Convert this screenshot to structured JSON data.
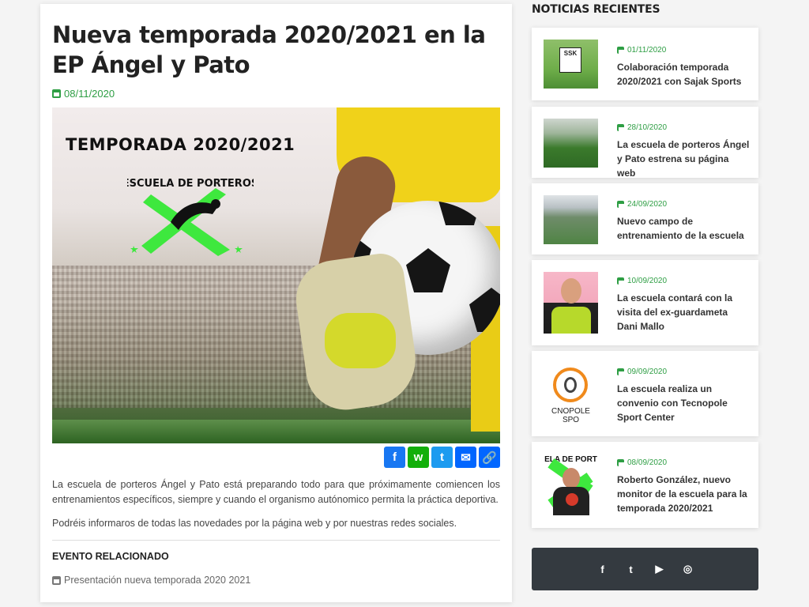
{
  "article": {
    "title": "Nueva temporada 2020/2021 en la EP Ángel y Pato",
    "date": "08/11/2020",
    "hero_heading": "TEMPORADA 2020/2021",
    "hero_logo_text": "ESCUELA DE PORTEROS",
    "share": [
      "f",
      "w",
      "t",
      "✉",
      "🔗"
    ],
    "paragraphs": [
      "La escuela de porteros Ángel y Pato está preparando todo para que próximamente comiencen los entrenamientos específicos, siempre y cuando el organismo autónomico permita la práctica deportiva.",
      "Podréis informaros de todas las novedades por la página web y por nuestras redes sociales."
    ],
    "related_heading": "EVENTO RELACIONADO",
    "related_link": "Presentación nueva temporada 2020 2021"
  },
  "sidebar": {
    "heading": "NOTICIAS RECIENTES",
    "news": [
      {
        "date": "01/11/2020",
        "title": "Colaboración temporada 2020/2021 con Sajak Sports",
        "thumb_text": "SSK"
      },
      {
        "date": "28/10/2020",
        "title": "La escuela de porteros Ángel y Pato estrena su página web"
      },
      {
        "date": "24/09/2020",
        "title": "Nuevo campo de entrenamiento de la escuela"
      },
      {
        "date": "10/09/2020",
        "title": "La escuela contará con la visita del ex-guardameta Dani Mallo"
      },
      {
        "date": "09/09/2020",
        "title": "La escuela realiza un convenio con Tecnopole Sport Center",
        "thumb_text": "CNOPOLE SPO"
      },
      {
        "date": "08/09/2020",
        "title": "Roberto González, nuevo monitor de la escuela para la temporada 2020/2021",
        "thumb_text": "ELA DE PORT"
      }
    ]
  },
  "social": [
    "f",
    "t",
    "▶",
    "◎"
  ],
  "colors": {
    "accent": "#2e9e44",
    "social_bg": "#343a40"
  }
}
